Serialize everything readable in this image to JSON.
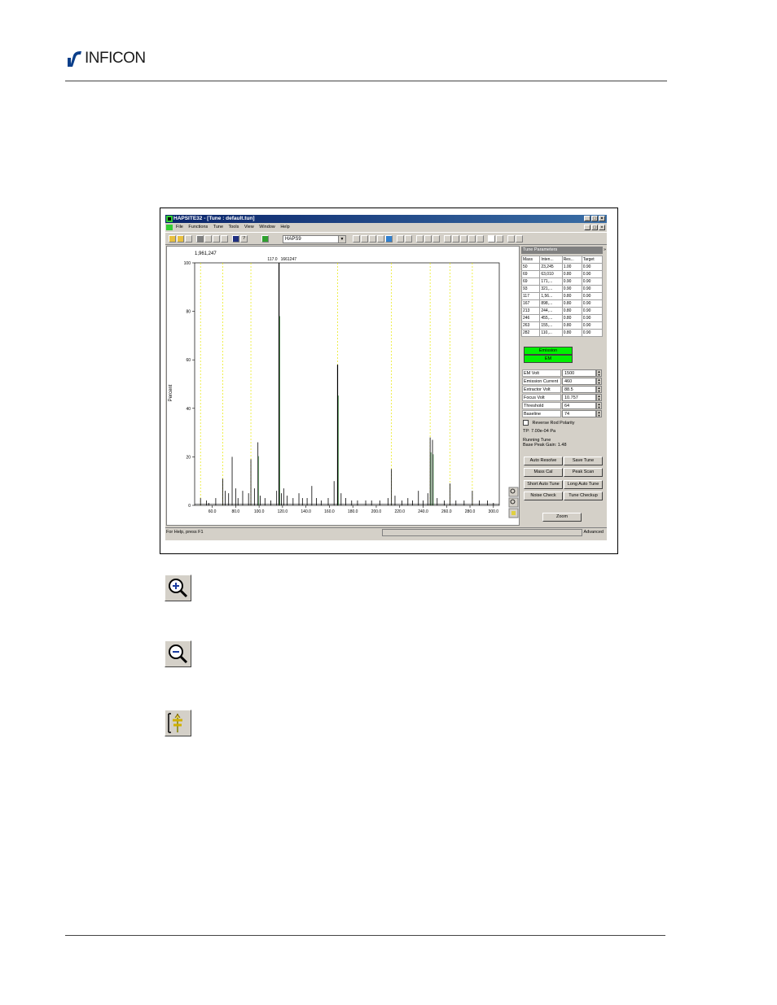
{
  "header": {
    "logo_text": "INFICON"
  },
  "window": {
    "title": "HAPSITE32 - [Tune : default.tun]",
    "controls": [
      "_",
      "□",
      "×"
    ]
  },
  "menu": [
    "File",
    "Functions",
    "Tune",
    "Tools",
    "View",
    "Window",
    "Help"
  ],
  "toolbar": {
    "method_combo": "HAPS9"
  },
  "plot": {
    "base_peak_abundance": "1,961,247",
    "peak_annotation_mass": "117.0",
    "peak_annotation_value": "1661247",
    "ylabel": "Percent",
    "ylim": [
      0,
      100
    ],
    "yticks": [
      "0",
      "20",
      "40",
      "60",
      "80",
      "100"
    ],
    "xticks": [
      "60.0",
      "80.0",
      "100.0",
      "120.0",
      "140.0",
      "160.0",
      "180.0",
      "200.0",
      "220.0",
      "240.0",
      "260.0",
      "280.0",
      "300.0"
    ],
    "xlim": [
      45,
      305
    ],
    "target_masses": [
      50,
      69,
      93,
      117,
      167,
      213,
      246,
      263,
      282
    ]
  },
  "chart_data": {
    "type": "line",
    "ylabel": "Percent",
    "ylim": [
      0,
      100
    ],
    "xlim": [
      45,
      305
    ],
    "x": [
      50,
      55,
      57,
      63,
      69,
      71,
      74,
      77,
      80,
      82,
      86,
      91,
      93,
      96,
      99,
      101,
      105,
      110,
      115,
      117,
      119,
      121,
      124,
      129,
      134,
      137,
      141,
      145,
      149,
      153,
      159,
      164,
      167,
      170,
      174,
      179,
      184,
      191,
      196,
      203,
      210,
      213,
      216,
      222,
      227,
      231,
      236,
      240,
      244,
      246,
      248,
      252,
      258,
      263,
      268,
      275,
      282,
      288,
      295,
      300
    ],
    "y": [
      3,
      2,
      1,
      3,
      11,
      6,
      5,
      20,
      7,
      3,
      6,
      5,
      19,
      7,
      26,
      4,
      3,
      2,
      6,
      100,
      5,
      7,
      4,
      3,
      5,
      3,
      3,
      8,
      3,
      2,
      3,
      10,
      58,
      5,
      3,
      2,
      2,
      2,
      2,
      2,
      3,
      15,
      4,
      2,
      3,
      2,
      6,
      2,
      5,
      28,
      27,
      3,
      2,
      9,
      2,
      2,
      6,
      2,
      2,
      1
    ]
  },
  "tune_table": {
    "title": "Tune Parameters",
    "headers": [
      "Mass",
      "Inten...",
      "Res...",
      "Target"
    ],
    "rows": [
      [
        "50",
        "23,245",
        "1.00",
        "0.90"
      ],
      [
        "69",
        "63,010",
        "0.80",
        "0.90"
      ],
      [
        "69",
        "171,...",
        "0.90",
        "0.90"
      ],
      [
        "93",
        "321,...",
        "0.90",
        "0.90"
      ],
      [
        "117",
        "1,56...",
        "0.80",
        "0.90"
      ],
      [
        "167",
        "898,...",
        "0.80",
        "0.90"
      ],
      [
        "213",
        "244,...",
        "0.80",
        "0.90"
      ],
      [
        "246",
        "455,...",
        "0.80",
        "0.90"
      ],
      [
        "263",
        "155,...",
        "0.80",
        "0.90"
      ],
      [
        "282",
        "110,...",
        "0.80",
        "0.90"
      ]
    ]
  },
  "status_buttons": {
    "emission": "Emission",
    "em": "EM"
  },
  "params": [
    {
      "label": "EM Volt",
      "value": "1500"
    },
    {
      "label": "Emission Current",
      "value": "460"
    },
    {
      "label": "Extractor Volt",
      "value": "88.5"
    },
    {
      "label": "Focus Volt",
      "value": "10.757"
    },
    {
      "label": "Threshold",
      "value": "64"
    },
    {
      "label": "Baseline",
      "value": "74"
    }
  ],
  "reverse_rod": "Reverse Rod Polarity",
  "info": {
    "tp": "TP: 7.00e-04 Pa",
    "running": "Running Tune",
    "gain": "Base Peak Gain: 1.48"
  },
  "buttons": {
    "auto_resolve": "Auto Resolve",
    "save_tune": "Save Tune",
    "mass_cal": "Mass Cal",
    "peak_scan": "Peak Scan",
    "short_auto": "Short Auto Tune",
    "long_auto": "Long Auto Tune",
    "noise_check": "Noise Check",
    "tune_checkup": "Tune Checkup",
    "zoom": "Zoom"
  },
  "status": {
    "help": "For Help, press F1",
    "mode": "Advanced"
  },
  "colors": {
    "title_bar": "#0a246a",
    "green": "#00f000",
    "guide": "#e8e800",
    "face": "#d4d0c8"
  }
}
